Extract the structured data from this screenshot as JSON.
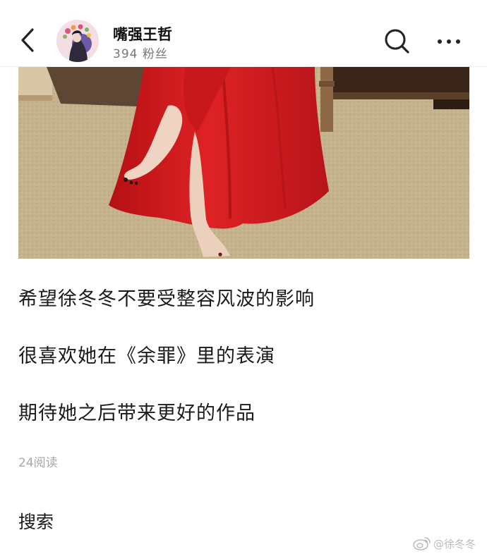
{
  "header": {
    "username": "嘴强王哲",
    "fans_label": "394 粉丝"
  },
  "post": {
    "lines": [
      "希望徐冬冬不要受整容风波的影响",
      "很喜欢她在《余罪》里的表演",
      "期待她之后带来更好的作品"
    ],
    "read_count": "24阅读"
  },
  "search_section": {
    "label": "搜索"
  },
  "watermark": {
    "text": "@徐冬冬"
  },
  "colors": {
    "dress_red": "#d21a1c",
    "carpet": "#c7b48f",
    "secondary_text": "#777777",
    "muted_text": "#a8a8a8"
  },
  "icons": [
    "back-arrow-icon",
    "search-icon",
    "more-icon",
    "weibo-logo-icon"
  ]
}
